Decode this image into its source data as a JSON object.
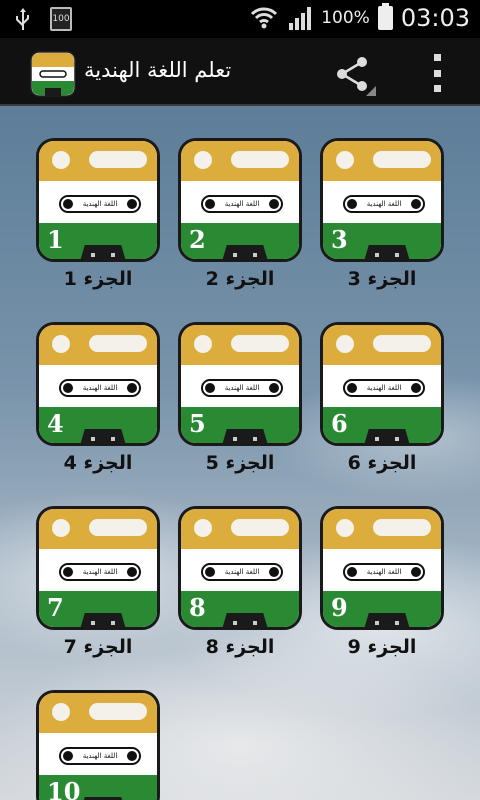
{
  "status_bar": {
    "battery_mini": "100",
    "battery_pct": "100%",
    "time": "03:03"
  },
  "app": {
    "title": "تعلم اللغة الهندية"
  },
  "tiles": [
    {
      "number": "1",
      "label": "الجزء 1",
      "cassette_text": "اللغة الهندية"
    },
    {
      "number": "2",
      "label": "الجزء 2",
      "cassette_text": "اللغة الهندية"
    },
    {
      "number": "3",
      "label": "الجزء 3",
      "cassette_text": "اللغة الهندية"
    },
    {
      "number": "4",
      "label": "الجزء 4",
      "cassette_text": "اللغة الهندية"
    },
    {
      "number": "5",
      "label": "الجزء 5",
      "cassette_text": "اللغة الهندية"
    },
    {
      "number": "6",
      "label": "الجزء 6",
      "cassette_text": "اللغة الهندية"
    },
    {
      "number": "7",
      "label": "الجزء 7",
      "cassette_text": "اللغة الهندية"
    },
    {
      "number": "8",
      "label": "الجزء 8",
      "cassette_text": "اللغة الهندية"
    },
    {
      "number": "9",
      "label": "الجزء 9",
      "cassette_text": "اللغة الهندية"
    },
    {
      "number": "10",
      "label": "",
      "cassette_text": "اللغة الهندية"
    }
  ],
  "icons": {
    "usb": "usb-icon",
    "battery_mini": "battery-mini-icon",
    "wifi": "wifi-icon",
    "signal": "signal-icon",
    "battery": "battery-icon",
    "share": "share-icon",
    "menu": "overflow-menu-icon"
  },
  "colors": {
    "saffron": "#dcad3c",
    "white": "#ffffff",
    "green": "#2a8a33",
    "actionbar": "#111111"
  }
}
